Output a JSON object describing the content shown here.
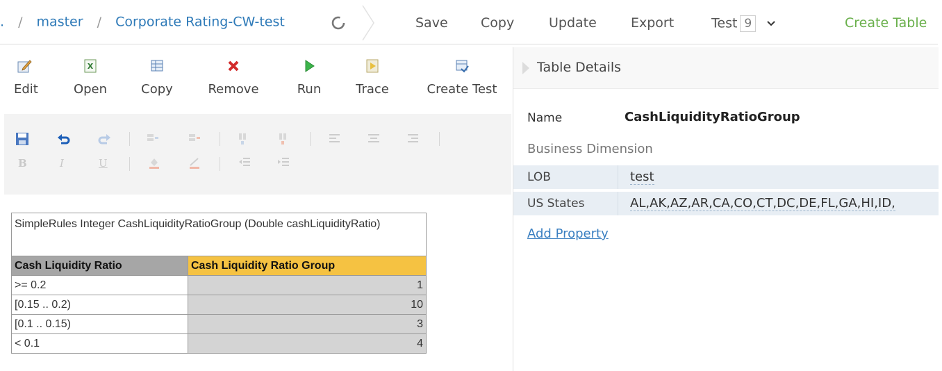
{
  "breadcrumb": {
    "ellipsis": ".",
    "items": [
      "master",
      "Corporate Rating-CW-test"
    ],
    "separator": "/"
  },
  "top_menu": {
    "save": "Save",
    "copy": "Copy",
    "update": "Update",
    "export": "Export",
    "test": "Test",
    "test_count": "9",
    "create_table": "Create Table"
  },
  "toolbar": {
    "edit": "Edit",
    "open": "Open",
    "copy": "Copy",
    "remove": "Remove",
    "run": "Run",
    "trace": "Trace",
    "create_test": "Create Test"
  },
  "format_toolbar": {
    "bold": "B",
    "italic": "I",
    "underline": "U"
  },
  "rules_table": {
    "header": "SimpleRules Integer CashLiquidityRatioGroup (Double cashLiquidityRatio)",
    "columns": [
      "Cash Liquidity Ratio",
      "Cash Liquidity Ratio Group"
    ],
    "rows": [
      [
        ">= 0.2",
        "1"
      ],
      [
        "[0.15 .. 0.2)",
        "10"
      ],
      [
        "[0.1 .. 0.15)",
        "3"
      ],
      [
        "< 0.1",
        "4"
      ]
    ]
  },
  "details": {
    "title": "Table Details",
    "name_label": "Name",
    "name_value": "CashLiquidityRatioGroup",
    "business_dimension": "Business Dimension",
    "props": [
      {
        "key": "LOB",
        "value": "test"
      },
      {
        "key": "US States",
        "value": "AL,AK,AZ,AR,CA,CO,CT,DC,DE,FL,GA,HI,ID,"
      }
    ],
    "add_property": "Add Property"
  },
  "colors": {
    "link_blue": "#2e7ab8",
    "create_green": "#6ab04c",
    "header_gray": "#a6a6a6",
    "header_gold": "#f5c242",
    "cell_gray": "#d4d4d4",
    "prop_row_bg": "#e8eef4"
  }
}
